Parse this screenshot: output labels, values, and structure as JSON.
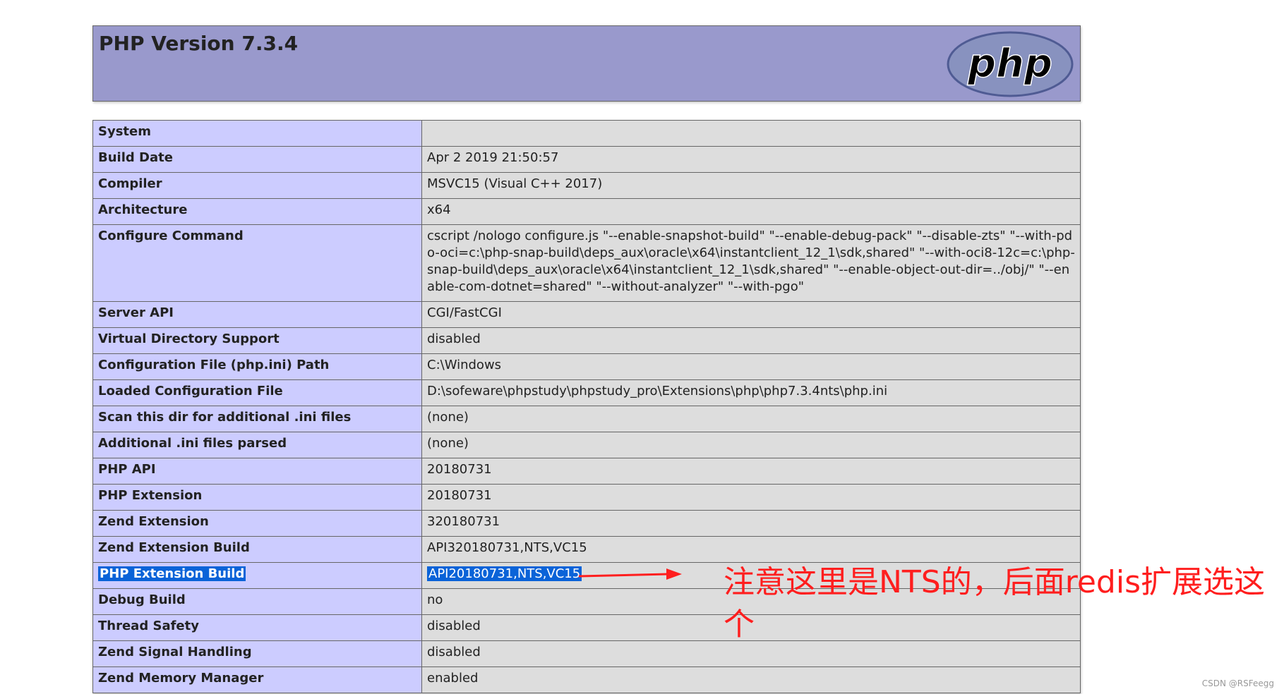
{
  "header": {
    "title": "PHP Version 7.3.4",
    "logo_text": "php",
    "logo_fill": "#8892bf",
    "logo_stroke": "#4f5b93"
  },
  "rows": [
    {
      "key": "System",
      "value": ""
    },
    {
      "key": "Build Date",
      "value": "Apr 2 2019 21:50:57"
    },
    {
      "key": "Compiler",
      "value": "MSVC15 (Visual C++ 2017)"
    },
    {
      "key": "Architecture",
      "value": "x64"
    },
    {
      "key": "Configure Command",
      "value": "cscript /nologo configure.js \"--enable-snapshot-build\" \"--enable-debug-pack\" \"--disable-zts\" \"--with-pdo-oci=c:\\php-snap-build\\deps_aux\\oracle\\x64\\instantclient_12_1\\sdk,shared\" \"--with-oci8-12c=c:\\php-snap-build\\deps_aux\\oracle\\x64\\instantclient_12_1\\sdk,shared\" \"--enable-object-out-dir=../obj/\" \"--enable-com-dotnet=shared\" \"--without-analyzer\" \"--with-pgo\""
    },
    {
      "key": "Server API",
      "value": "CGI/FastCGI"
    },
    {
      "key": "Virtual Directory Support",
      "value": "disabled"
    },
    {
      "key": "Configuration File (php.ini) Path",
      "value": "C:\\Windows"
    },
    {
      "key": "Loaded Configuration File",
      "value": "D:\\sofeware\\phpstudy\\phpstudy_pro\\Extensions\\php\\php7.3.4nts\\php.ini"
    },
    {
      "key": "Scan this dir for additional .ini files",
      "value": "(none)"
    },
    {
      "key": "Additional .ini files parsed",
      "value": "(none)"
    },
    {
      "key": "PHP API",
      "value": "20180731"
    },
    {
      "key": "PHP Extension",
      "value": "20180731"
    },
    {
      "key": "Zend Extension",
      "value": "320180731"
    },
    {
      "key": "Zend Extension Build",
      "value": "API320180731,NTS,VC15"
    },
    {
      "key": "PHP Extension Build",
      "value": "API20180731,NTS,VC15"
    },
    {
      "key": "Debug Build",
      "value": "no"
    },
    {
      "key": "Thread Safety",
      "value": "disabled"
    },
    {
      "key": "Zend Signal Handling",
      "value": "disabled"
    },
    {
      "key": "Zend Memory Manager",
      "value": "enabled"
    }
  ],
  "annotation": {
    "text": "注意这里是NTS的，后面redis扩展选这个",
    "color": "#ff1e1e"
  },
  "watermark": "CSDN @RSFeegg"
}
